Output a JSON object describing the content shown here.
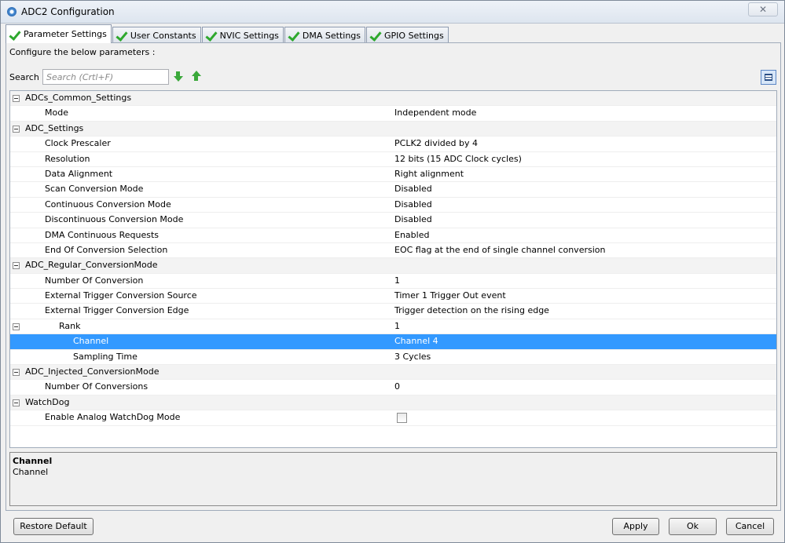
{
  "window": {
    "title": "ADC2 Configuration",
    "close_glyph": "✕"
  },
  "tabs": [
    {
      "label": "Parameter Settings",
      "icon": "check-icon",
      "active": true
    },
    {
      "label": "User Constants",
      "icon": "check-icon",
      "active": false
    },
    {
      "label": "NVIC Settings",
      "icon": "check-icon",
      "active": false
    },
    {
      "label": "DMA Settings",
      "icon": "check-icon",
      "active": false
    },
    {
      "label": "GPIO Settings",
      "icon": "check-icon",
      "active": false
    }
  ],
  "panel": {
    "intro": "Configure the below parameters :",
    "search_label": "Search :",
    "search_placeholder": "Search (Crtl+F)",
    "search_value": ""
  },
  "rows": [
    {
      "name": "ADCs_Common_Settings",
      "value": "",
      "kind": "group"
    },
    {
      "name": "Mode",
      "value": "Independent mode"
    },
    {
      "name": "ADC_Settings",
      "value": "",
      "kind": "group"
    },
    {
      "name": "Clock Prescaler",
      "value": "PCLK2 divided by 4"
    },
    {
      "name": "Resolution",
      "value": "12 bits (15 ADC Clock cycles)"
    },
    {
      "name": "Data Alignment",
      "value": "Right alignment"
    },
    {
      "name": "Scan Conversion Mode",
      "value": "Disabled"
    },
    {
      "name": "Continuous Conversion Mode",
      "value": "Disabled"
    },
    {
      "name": "Discontinuous Conversion Mode",
      "value": "Disabled"
    },
    {
      "name": "DMA Continuous Requests",
      "value": "Enabled"
    },
    {
      "name": "End Of Conversion Selection",
      "value": "EOC flag at the end of single channel conversion"
    },
    {
      "name": "ADC_Regular_ConversionMode",
      "value": "",
      "kind": "group"
    },
    {
      "name": "Number Of Conversion",
      "value": "1"
    },
    {
      "name": "External Trigger Conversion Source",
      "value": "Timer 1 Trigger Out event"
    },
    {
      "name": "External Trigger Conversion Edge",
      "value": "Trigger detection on the rising edge"
    },
    {
      "name": "Rank",
      "value": "1",
      "kind": "subgroup"
    },
    {
      "name": "Channel",
      "value": "Channel 4",
      "kind": "sub",
      "selected": true
    },
    {
      "name": "Sampling Time",
      "value": "3 Cycles",
      "kind": "sub"
    },
    {
      "name": "ADC_Injected_ConversionMode",
      "value": "",
      "kind": "group"
    },
    {
      "name": "Number Of Conversions",
      "value": "0"
    },
    {
      "name": "WatchDog",
      "value": "",
      "kind": "group"
    },
    {
      "name": "Enable Analog WatchDog Mode",
      "value": "",
      "checkbox": true,
      "checked": false
    }
  ],
  "description": {
    "title": "Channel",
    "text": "Channel"
  },
  "buttons": {
    "restore": "Restore Default",
    "apply": "Apply",
    "ok": "Ok",
    "cancel": "Cancel"
  },
  "colors": {
    "selection": "#3399ff",
    "check": "#2ea82e"
  }
}
